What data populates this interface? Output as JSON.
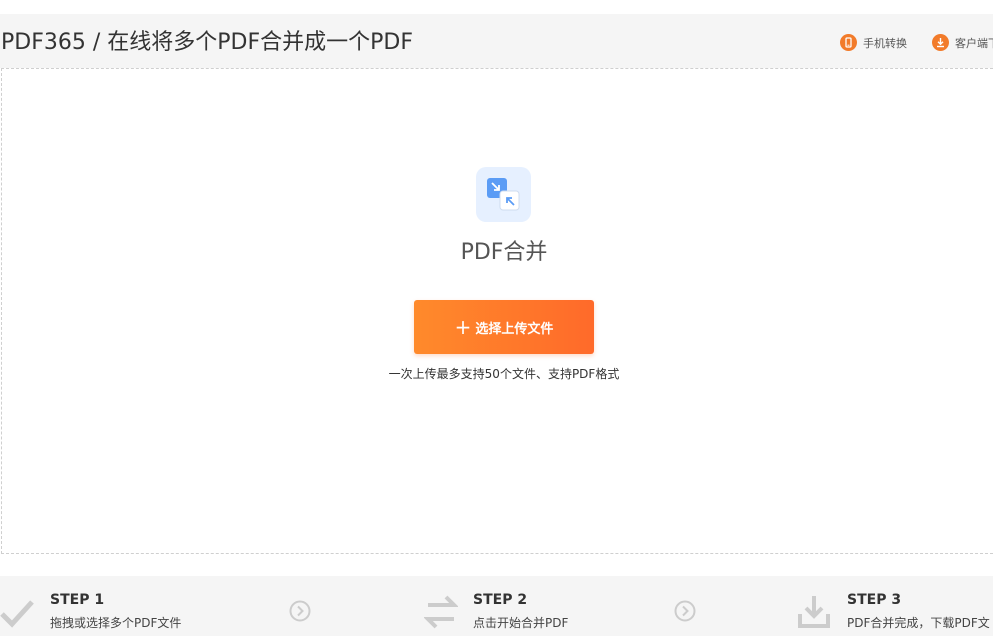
{
  "header": {
    "title": "PDF365 / 在线将多个PDF合并成一个PDF",
    "links": [
      {
        "label": "手机转换",
        "icon": "phone-icon"
      },
      {
        "label": "客户端下",
        "icon": "download-icon"
      }
    ]
  },
  "tool": {
    "icon": "merge-icon",
    "name": "PDF合并",
    "upload_button_label": "选择上传文件",
    "upload_hint": "一次上传最多支持50个文件、支持PDF格式"
  },
  "steps": [
    {
      "label": "STEP 1",
      "desc": "拖拽或选择多个PDF文件",
      "icon": "check-icon"
    },
    {
      "label": "STEP 2",
      "desc": "点击开始合并PDF",
      "icon": "swap-icon"
    },
    {
      "label": "STEP 3",
      "desc": "PDF合并完成，下载PDF文",
      "icon": "download-tray-icon"
    }
  ],
  "colors": {
    "accent": "#ff7a2b",
    "tool_icon_bg": "#e6f0ff",
    "step_icon": "#cccccc"
  }
}
